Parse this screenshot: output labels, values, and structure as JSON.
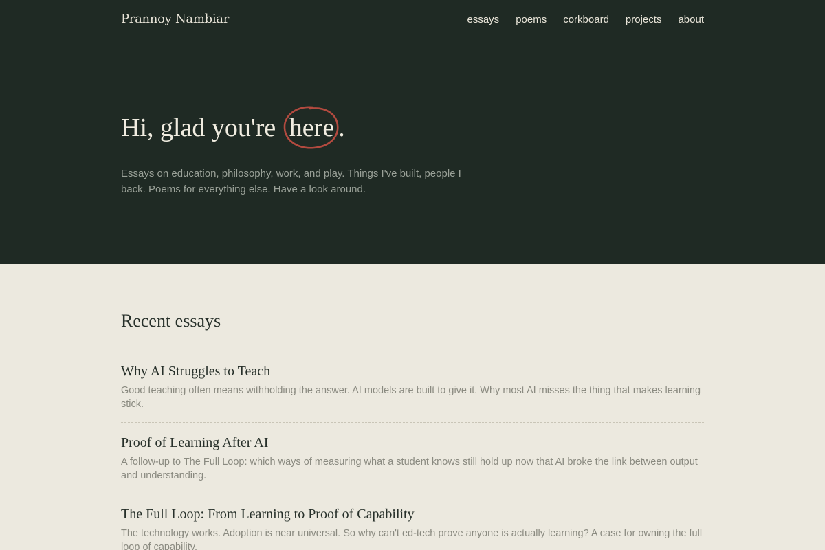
{
  "site": {
    "title": "Prannoy Nambiar"
  },
  "nav": {
    "items": [
      "essays",
      "poems",
      "corkboard",
      "projects",
      "about"
    ]
  },
  "hero": {
    "headline_before": "Hi, glad you're",
    "headline_circled": "here",
    "headline_after": ".",
    "intro": "Essays on education, philosophy, work, and play. Things I've built, people I back. Poems for everything else. Have a look around."
  },
  "recent": {
    "title": "Recent essays",
    "essays": [
      {
        "title": "Why AI Struggles to Teach",
        "description": "Good teaching often means withholding the answer. AI models are built to give it. Why most AI misses the thing that makes learning stick."
      },
      {
        "title": "Proof of Learning After AI",
        "description": "A follow-up to The Full Loop: which ways of measuring what a student knows still hold up now that AI broke the link between output and understanding."
      },
      {
        "title": "The Full Loop: From Learning to Proof of Capability",
        "description": "The technology works. Adoption is near universal. So why can't ed-tech prove anyone is actually learning? A case for owning the full loop of capability."
      }
    ]
  },
  "colors": {
    "hero_bg": "#1f2a24",
    "page_bg": "#ece9df",
    "circle_accent": "#b34a3f"
  }
}
